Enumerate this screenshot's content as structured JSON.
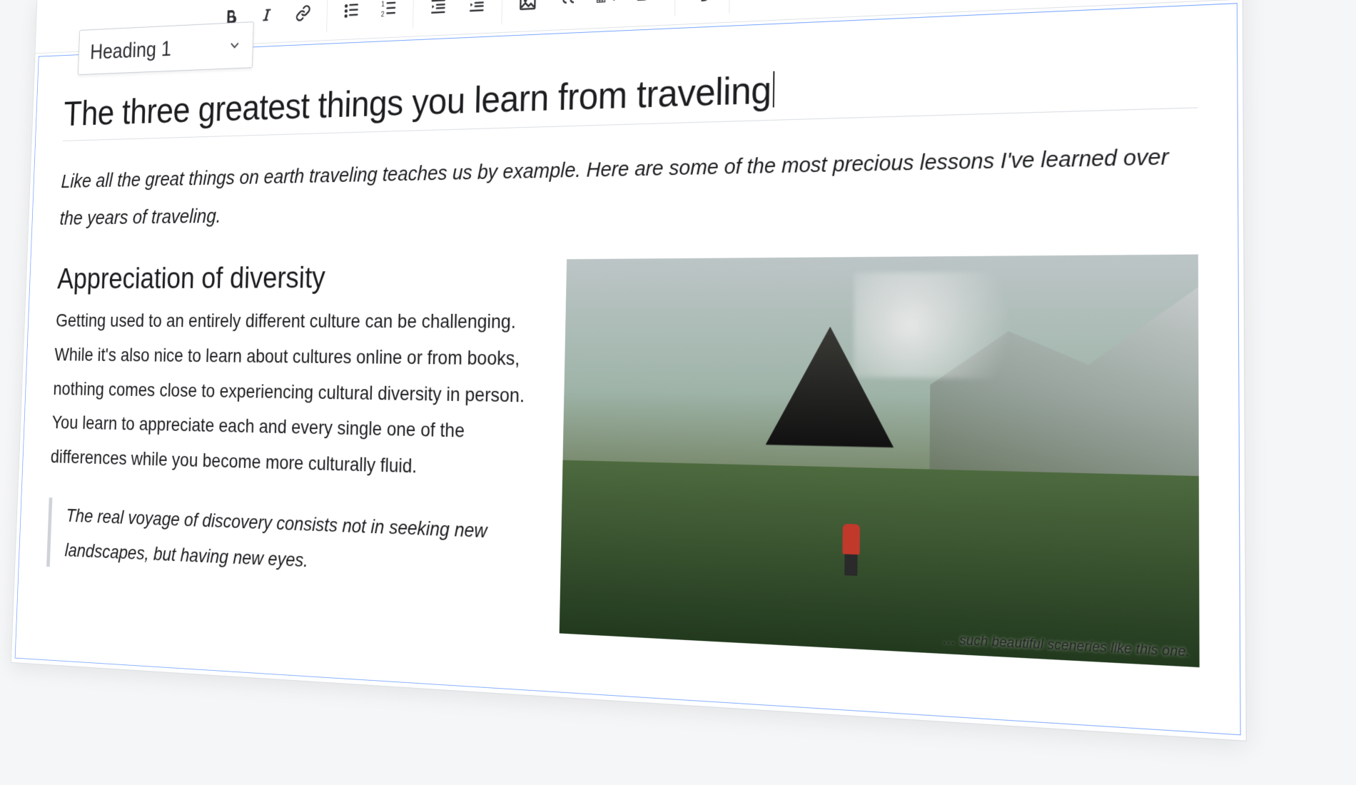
{
  "toolbar": {
    "style_selector": {
      "value": "Heading 1"
    },
    "buttons": {
      "bold": "Bold",
      "italic": "Italic",
      "link": "Link",
      "ul": "Bulleted list",
      "ol": "Numbered list",
      "indent": "Increase indent",
      "outdent": "Decrease indent",
      "image": "Insert image",
      "quote": "Block quote",
      "table": "Insert table",
      "media": "Insert media",
      "undo": "Undo"
    }
  },
  "document": {
    "h1": "The three greatest things you learn from traveling",
    "intro": "Like all the great things on earth traveling teaches us by example. Here are some of the most precious lessons I've learned over the years of traveling.",
    "h2_1": "Appreciation of diversity",
    "p1": "Getting used to an entirely different culture can be challenging. While it's also nice to learn about cultures online or from books, nothing comes close to experiencing cultural diversity in person. You learn to appreciate each and every single one of the differences while you become more culturally fluid.",
    "quote": "The real voyage of discovery consists not in seeking new landscapes, but having new eyes.",
    "image_caption": "… such beautiful sceneries like this one."
  }
}
